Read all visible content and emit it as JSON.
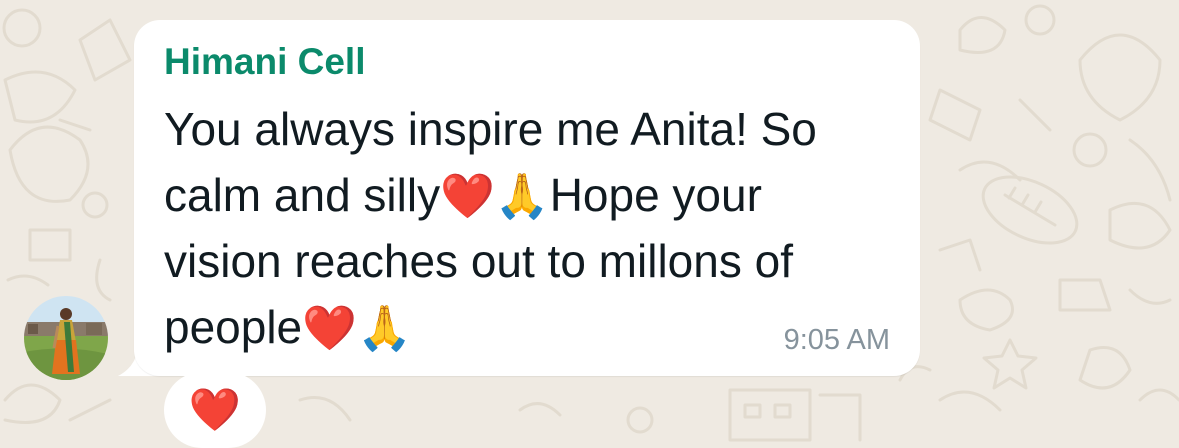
{
  "conversation": {
    "sender_name": "Himani Cell",
    "sender_color": "#0b8a6b",
    "message_lines": [
      {
        "text_before": "You always inspire me Anita! So",
        "emoji_a": "",
        "emoji_b": "",
        "text_after": ""
      },
      {
        "text_before": "calm and silly",
        "emoji_a": "❤️",
        "emoji_b": "🙏",
        "text_after": "Hope your"
      },
      {
        "text_before": "vision reaches out to millons of",
        "emoji_a": "",
        "emoji_b": "",
        "text_after": ""
      },
      {
        "text_before": "people",
        "emoji_a": "❤️",
        "emoji_b": "🙏",
        "text_after": ""
      }
    ],
    "timestamp": "9:05 AM",
    "reaction_emoji": "❤️",
    "avatar_icon": "profile-photo-woman-in-saree",
    "bubble_color": "#ffffff",
    "background_color": "#efeae2"
  }
}
